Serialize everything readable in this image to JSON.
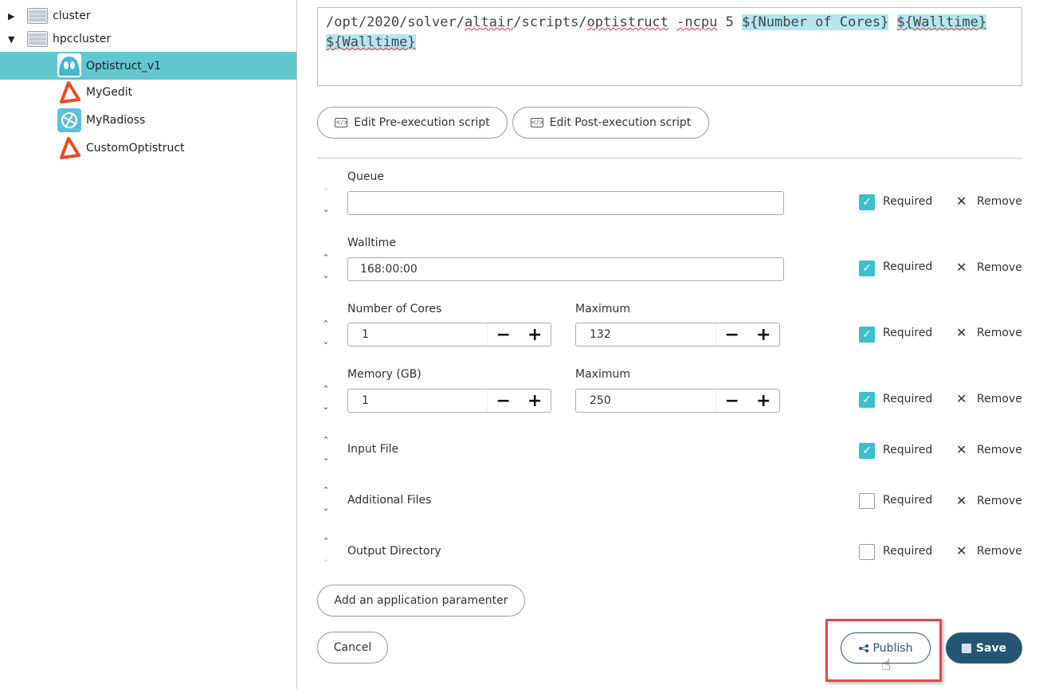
{
  "sidebar": {
    "tree": [
      {
        "label": "cluster",
        "expanded": false,
        "icon": "server-icon"
      },
      {
        "label": "hpccluster",
        "expanded": true,
        "icon": "server-icon"
      },
      {
        "label": "Optistruct_v1",
        "selected": true,
        "icon": "optistruct-app-icon"
      },
      {
        "label": "MyGedit",
        "icon": "altair-logo-icon"
      },
      {
        "label": "MyRadioss",
        "icon": "radioss-app-icon"
      },
      {
        "label": "CustomOptistruct",
        "icon": "altair-logo-icon"
      }
    ]
  },
  "script": {
    "p1": "/opt/2020/solver/",
    "p2": "altair",
    "p3": "/scripts/",
    "p4": "optistruct",
    "p5": " ",
    "p6": "-ncpu",
    "p7": " 5 ",
    "var1": "${Number of Cores}",
    "var2": "${Walltime}",
    "var3": "${Walltime}"
  },
  "buttons": {
    "pre": "Edit Pre-execution script",
    "post": "Edit Post-execution script",
    "add": "Add an application paramenter",
    "cancel": "Cancel",
    "publish": "Publish",
    "save": "Save"
  },
  "params": [
    {
      "label": "Queue",
      "value": "",
      "required": true
    },
    {
      "label": "Walltime",
      "value": "168:00:00",
      "required": true
    },
    {
      "label": "Number of Cores",
      "value": "1",
      "max_label": "Maximum",
      "max": "132",
      "required": true
    },
    {
      "label": "Memory (GB)",
      "value": "1",
      "max_label": "Maximum",
      "max": "250",
      "required": true
    },
    {
      "label": "Input File",
      "required": true
    },
    {
      "label": "Additional Files",
      "required": false
    },
    {
      "label": "Output Directory",
      "required": false
    }
  ],
  "common": {
    "required": "Required",
    "remove": "Remove",
    "minus": "−",
    "plus": "+",
    "up": "⌃",
    "down": "⌄",
    "check": "✓",
    "x": "✕"
  },
  "colors": {
    "accent": "#3cc0cc",
    "selected": "#62c8d0",
    "save": "#245673",
    "highlight": "#e8464a"
  }
}
